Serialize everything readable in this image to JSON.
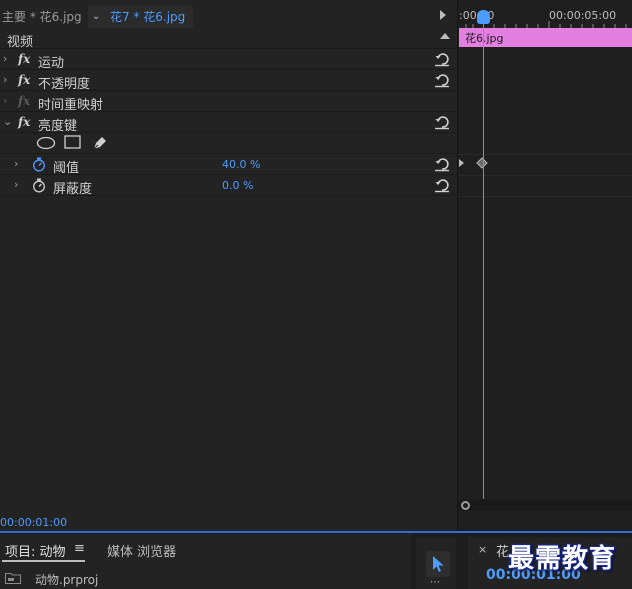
{
  "header": {
    "master_clip": "主要 * 花6.jpg",
    "sequence_clip": "花7 * 花6.jpg"
  },
  "sections": {
    "video": "视频"
  },
  "effects": [
    {
      "name": "运动",
      "expanded": false,
      "enabled": true
    },
    {
      "name": "不透明度",
      "expanded": false,
      "enabled": true
    },
    {
      "name": "时间重映射",
      "expanded": false,
      "enabled": false
    },
    {
      "name": "亮度键",
      "expanded": true,
      "enabled": true
    }
  ],
  "mask_tools": [
    "ellipse-mask-icon",
    "rectangle-mask-icon",
    "pen-mask-icon"
  ],
  "properties": [
    {
      "name": "阈值",
      "value": "40.0 %",
      "animated": true
    },
    {
      "name": "屏蔽度",
      "value": "0.0 %",
      "animated": false
    }
  ],
  "timeline": {
    "start_label": ":00:00",
    "mid_label": "00:00:05:00",
    "clip_name": "花6.jpg"
  },
  "current_timecode": "00:00:01:00",
  "bottom": {
    "project_tab": "项目: 动物",
    "menu_icon": "≡",
    "media_browser": "媒体 浏览器",
    "project_file": "动物.prproj",
    "seq_close": "×",
    "seq_tab": "花",
    "seq_timecode": "00:00:01:00",
    "tool_dots": "⋯"
  },
  "watermark": "最需教育",
  "colors": {
    "accent": "#4d9cff",
    "clip": "#e27fe0",
    "panel": "#232323"
  }
}
